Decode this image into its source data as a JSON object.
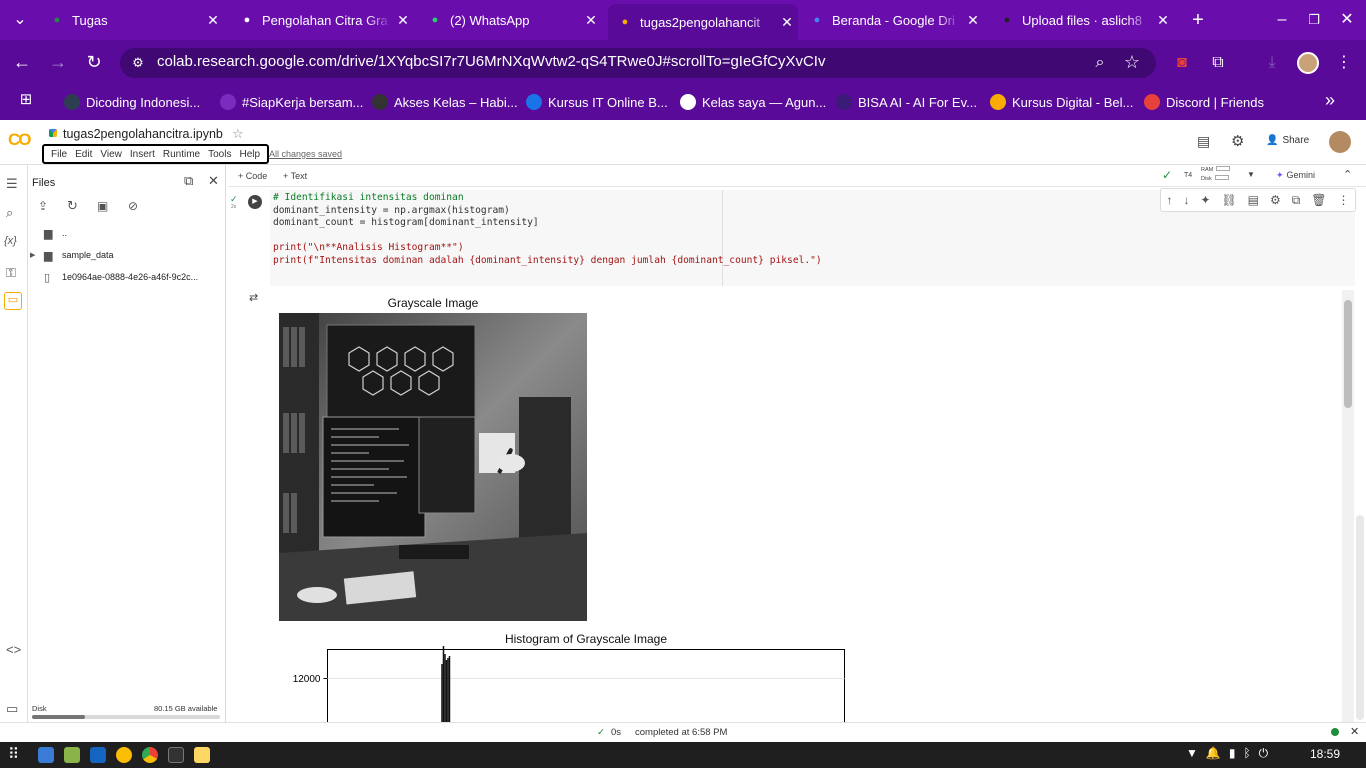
{
  "browser": {
    "tabs": [
      {
        "title": "Tugas",
        "icon": "google-classroom-icon",
        "color": "#1e8e3e"
      },
      {
        "title": "Pengolahan Citra Gra",
        "icon": "chatgpt-icon",
        "color": "#ffffff"
      },
      {
        "title": "(2) WhatsApp",
        "icon": "whatsapp-icon",
        "color": "#25d366"
      },
      {
        "title": "tugas2pengolahancit",
        "icon": "colab-icon",
        "color": "#f9ab00"
      },
      {
        "title": "Beranda - Google Dri",
        "icon": "google-drive-icon",
        "color": "#4285f4"
      },
      {
        "title": "Upload files · aslich8",
        "icon": "github-icon",
        "color": "#222222"
      }
    ],
    "url": "colab.research.google.com/drive/1XYqbcSI7r7U6MrNXqWvtw2-qS4TRwe0J#scrollTo=gIeGfCyXvCIv",
    "bookmarks": [
      {
        "label": "Dicoding Indonesi...",
        "icon": "dicoding-icon",
        "color": "#2d3e50",
        "glyph": "g"
      },
      {
        "label": "#SiapKerja bersam...",
        "icon": "kemnaker-icon",
        "color": "#7b2cbf",
        "glyph": "K"
      },
      {
        "label": "Akses Kelas – Habi...",
        "icon": "habibi-icon",
        "color": "#333",
        "glyph": "H"
      },
      {
        "label": "Kursus IT Online B...",
        "icon": "course-icon",
        "color": "#1a73e8",
        "glyph": "S"
      },
      {
        "label": "Kelas saya — Agun...",
        "icon": "agung-icon",
        "color": "#ffffff",
        "glyph": "a"
      },
      {
        "label": "BISA AI - AI For Ev...",
        "icon": "bisa-ai-icon",
        "color": "#3c1a78",
        "glyph": "•"
      },
      {
        "label": "Kursus Digital - Bel...",
        "icon": "course-digital-icon",
        "color": "#f9ab00",
        "glyph": "•"
      },
      {
        "label": "Discord | Friends",
        "icon": "discord-icon",
        "color": "#e8403a",
        "glyph": "3k+"
      }
    ]
  },
  "colab": {
    "notebook_name": "tugas2pengolahancitra.ipynb",
    "menu": [
      "File",
      "Edit",
      "View",
      "Insert",
      "Runtime",
      "Tools",
      "Help"
    ],
    "save_status": "All changes saved",
    "share_label": "Share",
    "add_code": "+ Code",
    "add_text": "+ Text",
    "runtime": {
      "type": "T4",
      "ram": "RAM",
      "disk": "Disk"
    },
    "gemini": "Gemini"
  },
  "files_panel": {
    "title": "Files",
    "items": [
      {
        "name": "..",
        "type": "folder"
      },
      {
        "name": "sample_data",
        "type": "folder"
      },
      {
        "name": "1e0964ae-0888-4e26-a46f-9c2c...",
        "type": "file"
      }
    ],
    "disk_label": "Disk",
    "disk_available": "80.15 GB available",
    "disk_used_fraction": 0.28
  },
  "cell": {
    "exec_time": "2s",
    "lines": [
      "# Identifikasi intensitas dominan",
      "dominant_intensity = np.argmax(histogram)",
      "dominant_count = histogram[dominant_intensity]",
      "",
      "print(\"\\n**Analisis Histogram**\")",
      "print(f\"Intensitas dominan adalah {dominant_intensity} dengan jumlah {dominant_count} piksel.\")"
    ]
  },
  "output": {
    "image_title": "Grayscale Image",
    "histogram_title": "Histogram of Grayscale Image",
    "chart_data": {
      "type": "bar",
      "title": "Histogram of Grayscale Image",
      "yticks": [
        12000
      ],
      "peak_count": 12700,
      "peak_bin_fraction": 0.22,
      "visible_ymin": 10500
    }
  },
  "statusbar": {
    "check": "✓",
    "time": "0s",
    "message": "completed at 6:58 PM"
  },
  "taskbar": {
    "clock": "18:59"
  }
}
